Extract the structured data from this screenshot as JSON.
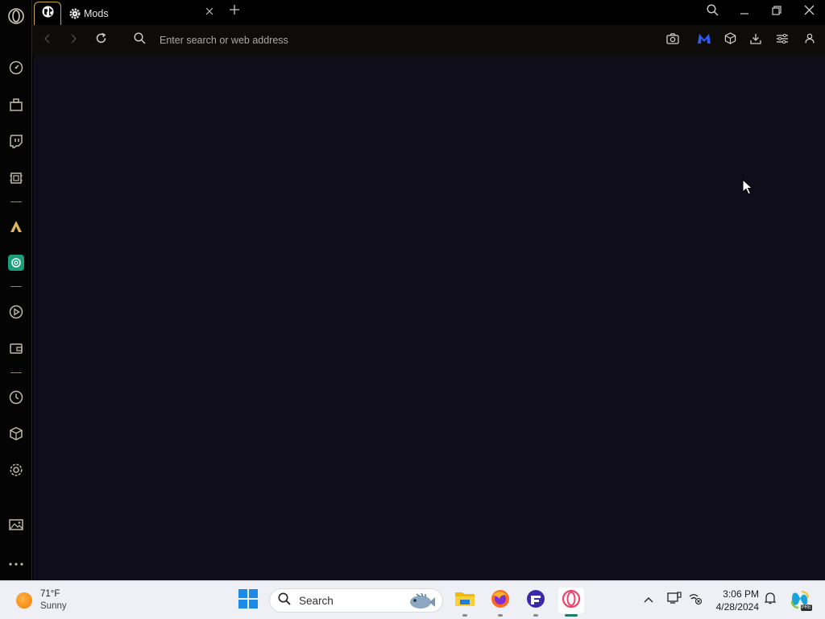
{
  "browser": {
    "tabs": [
      {
        "label": ""
      },
      {
        "label": "Mods"
      }
    ],
    "address_bar": {
      "placeholder": "Enter search or web address",
      "value": ""
    },
    "accent_color": "#c9a83a",
    "content_bg": "#100d1b"
  },
  "sidebar": {
    "items": [
      {
        "name": "opera-logo-icon"
      },
      {
        "name": "speed-dial-icon"
      },
      {
        "name": "extensions-icon"
      },
      {
        "name": "twitch-icon"
      },
      {
        "name": "gx-control-icon"
      },
      {
        "name": "aria-icon"
      },
      {
        "name": "chatgpt-icon"
      },
      {
        "name": "player-icon"
      },
      {
        "name": "wallet-icon"
      },
      {
        "name": "history-icon"
      },
      {
        "name": "mods-icon"
      },
      {
        "name": "settings-icon"
      },
      {
        "name": "gallery-icon"
      },
      {
        "name": "more-icon"
      }
    ]
  },
  "taskbar": {
    "weather": {
      "temp": "71°F",
      "condition": "Sunny"
    },
    "search_label": "Search",
    "clock": {
      "time": "3:06 PM",
      "date": "4/28/2024"
    },
    "copilot_badge": "PRE"
  }
}
